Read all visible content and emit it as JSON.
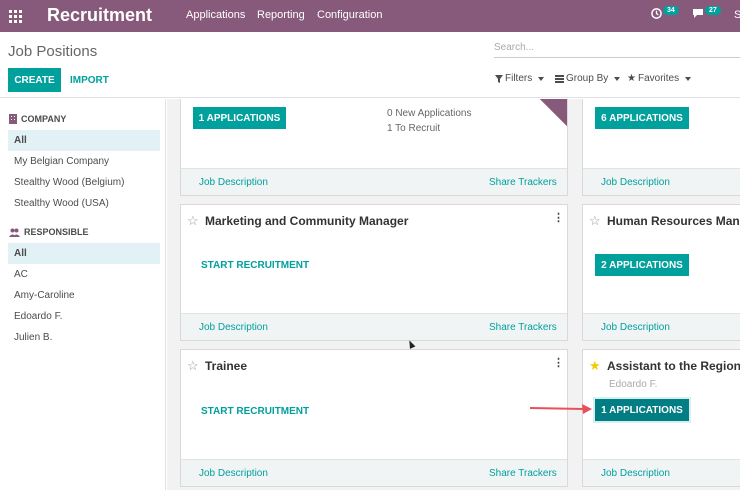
{
  "topbar": {
    "app_title": "Recruitment",
    "menu": [
      "Applications",
      "Reporting",
      "Configuration"
    ],
    "activity_count": "34",
    "message_count": "27",
    "user_initial": "S",
    "bg_color": "#875a7b"
  },
  "control_panel": {
    "breadcrumb": "Job Positions",
    "search_placeholder": "Search...",
    "create_label": "CREATE",
    "import_label": "IMPORT",
    "filters_label": "Filters",
    "group_by_label": "Group By",
    "favorites_label": "Favorites"
  },
  "sidebar": {
    "company_heading": "COMPANY",
    "companies": [
      "All",
      "My Belgian Company",
      "Stealthy Wood (Belgium)",
      "Stealthy Wood (USA)"
    ],
    "responsible_heading": "RESPONSIBLE",
    "responsibles": [
      "All",
      "AC",
      "Amy-Caroline",
      "Edoardo F.",
      "Julien B."
    ]
  },
  "cards": {
    "c1": {
      "button": "1 APPLICATIONS",
      "new_apps": "0 New Applications",
      "to_recruit": "1 To Recruit",
      "job_desc": "Job Description",
      "share": "Share Trackers"
    },
    "c2": {
      "button": "6 APPLICATIONS",
      "job_desc": "Job Description"
    },
    "c3": {
      "title": "Marketing and Community Manager",
      "start": "START RECRUITMENT",
      "job_desc": "Job Description",
      "share": "Share Trackers"
    },
    "c4": {
      "title": "Human Resources Mana",
      "button": "2 APPLICATIONS",
      "job_desc": "Job Description"
    },
    "c5": {
      "title": "Trainee",
      "start": "START RECRUITMENT",
      "job_desc": "Job Description",
      "share": "Share Trackers"
    },
    "c6": {
      "title": "Assistant to the Regiona",
      "responsible": "Edoardo F.",
      "button": "1 APPLICATIONS",
      "job_desc": "Job Description"
    }
  },
  "colors": {
    "accent": "#00a09d",
    "brand": "#875a7b",
    "annotation_arrow": "#e8505b"
  }
}
